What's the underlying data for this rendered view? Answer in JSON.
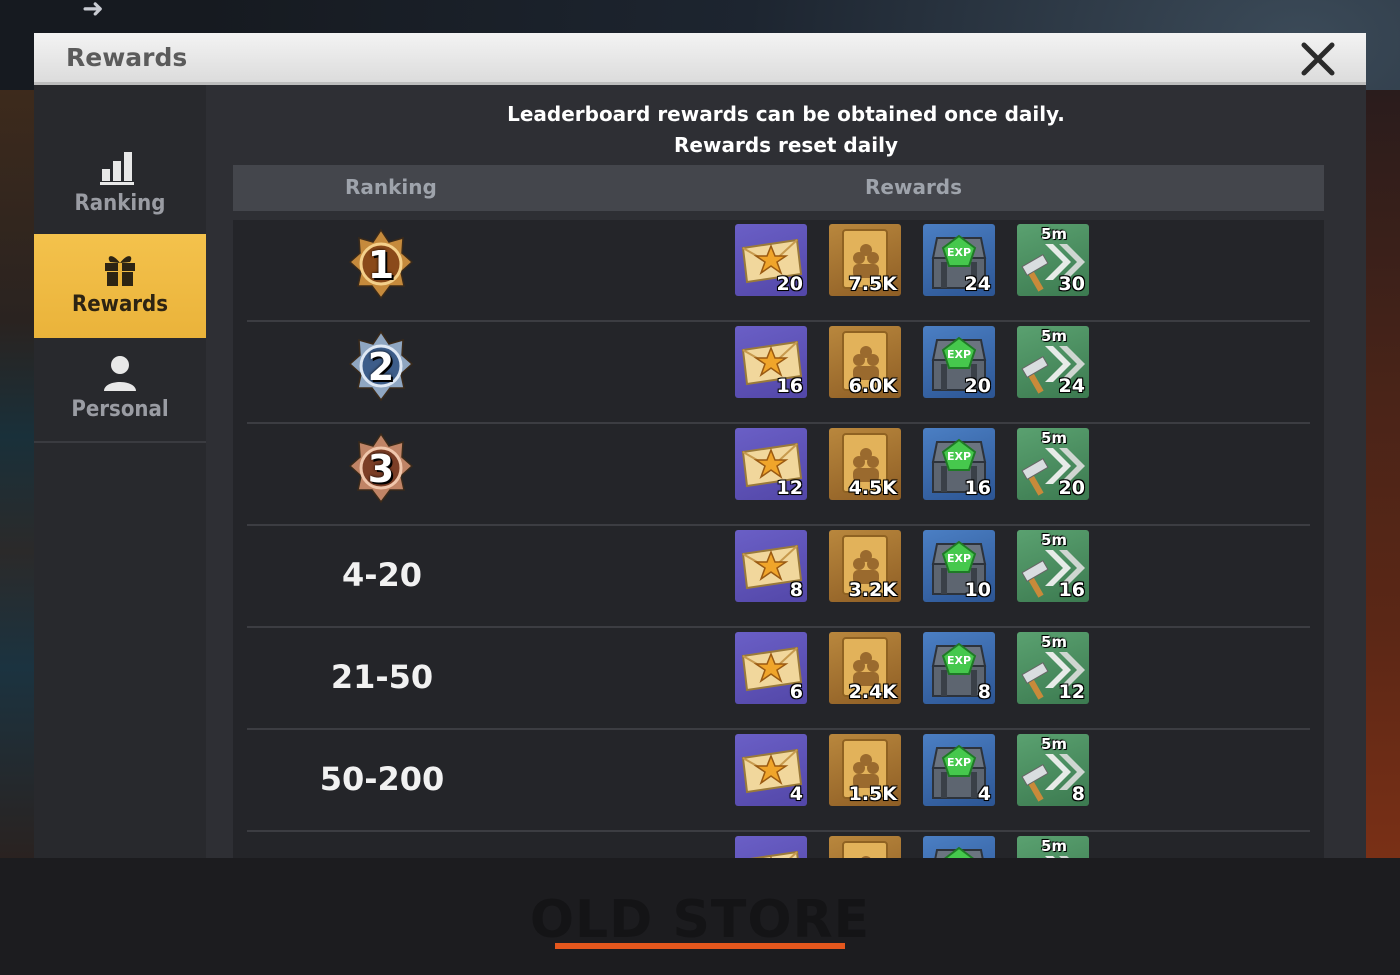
{
  "dialog": {
    "title": "Rewards",
    "notice_line1": "Leaderboard rewards can be obtained once daily.",
    "notice_line2": "Rewards reset daily"
  },
  "sidebar": {
    "items": [
      {
        "label": "Ranking",
        "icon": "bar-chart-icon",
        "active": false
      },
      {
        "label": "Rewards",
        "icon": "gift-icon",
        "active": true
      },
      {
        "label": "Personal",
        "icon": "person-icon",
        "active": false
      }
    ]
  },
  "table": {
    "headers": {
      "ranking": "Ranking",
      "rewards": "Rewards"
    },
    "reward_types": [
      "star-envelope-icon",
      "gold-supply-envelope-icon",
      "exp-chest-icon",
      "speedup-hammer-icon"
    ],
    "speedup_tag": "5m",
    "rows": [
      {
        "rank": "1",
        "rank_kind": "medal-gold",
        "rewards": [
          "20",
          "7.5K",
          "24",
          "30"
        ]
      },
      {
        "rank": "2",
        "rank_kind": "medal-silver",
        "rewards": [
          "16",
          "6.0K",
          "20",
          "24"
        ]
      },
      {
        "rank": "3",
        "rank_kind": "medal-bronze",
        "rewards": [
          "12",
          "4.5K",
          "16",
          "20"
        ]
      },
      {
        "rank": "4-20",
        "rank_kind": "text",
        "rewards": [
          "8",
          "3.2K",
          "10",
          "16"
        ]
      },
      {
        "rank": "21-50",
        "rank_kind": "text",
        "rewards": [
          "6",
          "2.4K",
          "8",
          "12"
        ]
      },
      {
        "rank": "50-200",
        "rank_kind": "text",
        "rewards": [
          "4",
          "1.5K",
          "4",
          "8"
        ]
      },
      {
        "rank": "",
        "rank_kind": "text",
        "rewards": [
          "",
          "",
          "",
          ""
        ]
      }
    ]
  },
  "footer": {
    "brand": "OLD STORE"
  },
  "colors": {
    "accent_tab": "#f0bb45",
    "footer_underline": "#e4571d"
  }
}
